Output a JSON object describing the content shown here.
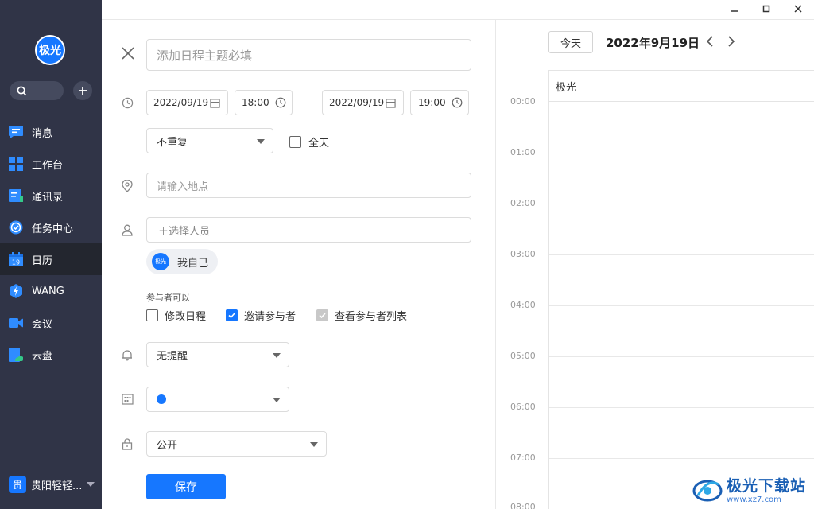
{
  "sidebar": {
    "avatar_text": "极光",
    "items": [
      {
        "label": "消息",
        "icon": "message-icon",
        "color": "#2f8cff"
      },
      {
        "label": "工作台",
        "icon": "workbench-icon",
        "color": "#2f8cff"
      },
      {
        "label": "通讯录",
        "icon": "contacts-icon",
        "color": "#2f8cff"
      },
      {
        "label": "任务中心",
        "icon": "task-icon",
        "color": "#2f8cff"
      },
      {
        "label": "日历",
        "icon": "calendar-icon",
        "color": "#2f8cff",
        "active": true
      },
      {
        "label": "WANG",
        "icon": "wang-icon",
        "color": "#2f8cff"
      },
      {
        "label": "会议",
        "icon": "meeting-icon",
        "color": "#2f8cff"
      },
      {
        "label": "云盘",
        "icon": "cloud-disk-icon",
        "color": "#2f8cff"
      }
    ],
    "calendar_icon_day": "19",
    "org_badge": "贵",
    "org_name": "贵阳轻轻..."
  },
  "form": {
    "title_placeholder": "添加日程主题必填",
    "start_date": "2022/09/19",
    "start_time": "18:00",
    "end_date": "2022/09/19",
    "end_time": "19:00",
    "repeat": "不重复",
    "all_day_label": "全天",
    "location_placeholder": "请输入地点",
    "participants_placeholder": "＋选择人员",
    "participant_chip_avatar": "极光",
    "participant_chip_name": "我自己",
    "perms_title": "参与者可以",
    "perm_edit": "修改日程",
    "perm_invite": "邀请参与者",
    "perm_view": "查看参与者列表",
    "reminder": "无提醒",
    "visibility": "公开",
    "save_label": "保存"
  },
  "calendar": {
    "today_label": "今天",
    "date_title": "2022年9月19日",
    "column_header": "极光",
    "hours": [
      "00:00",
      "01:00",
      "02:00",
      "03:00",
      "04:00",
      "05:00",
      "06:00",
      "07:00",
      "08:00"
    ]
  },
  "watermark": {
    "main": "极光下载站",
    "sub": "www.xz7.com"
  },
  "colors": {
    "accent": "#1677ff",
    "sidebar_bg": "#303447"
  }
}
